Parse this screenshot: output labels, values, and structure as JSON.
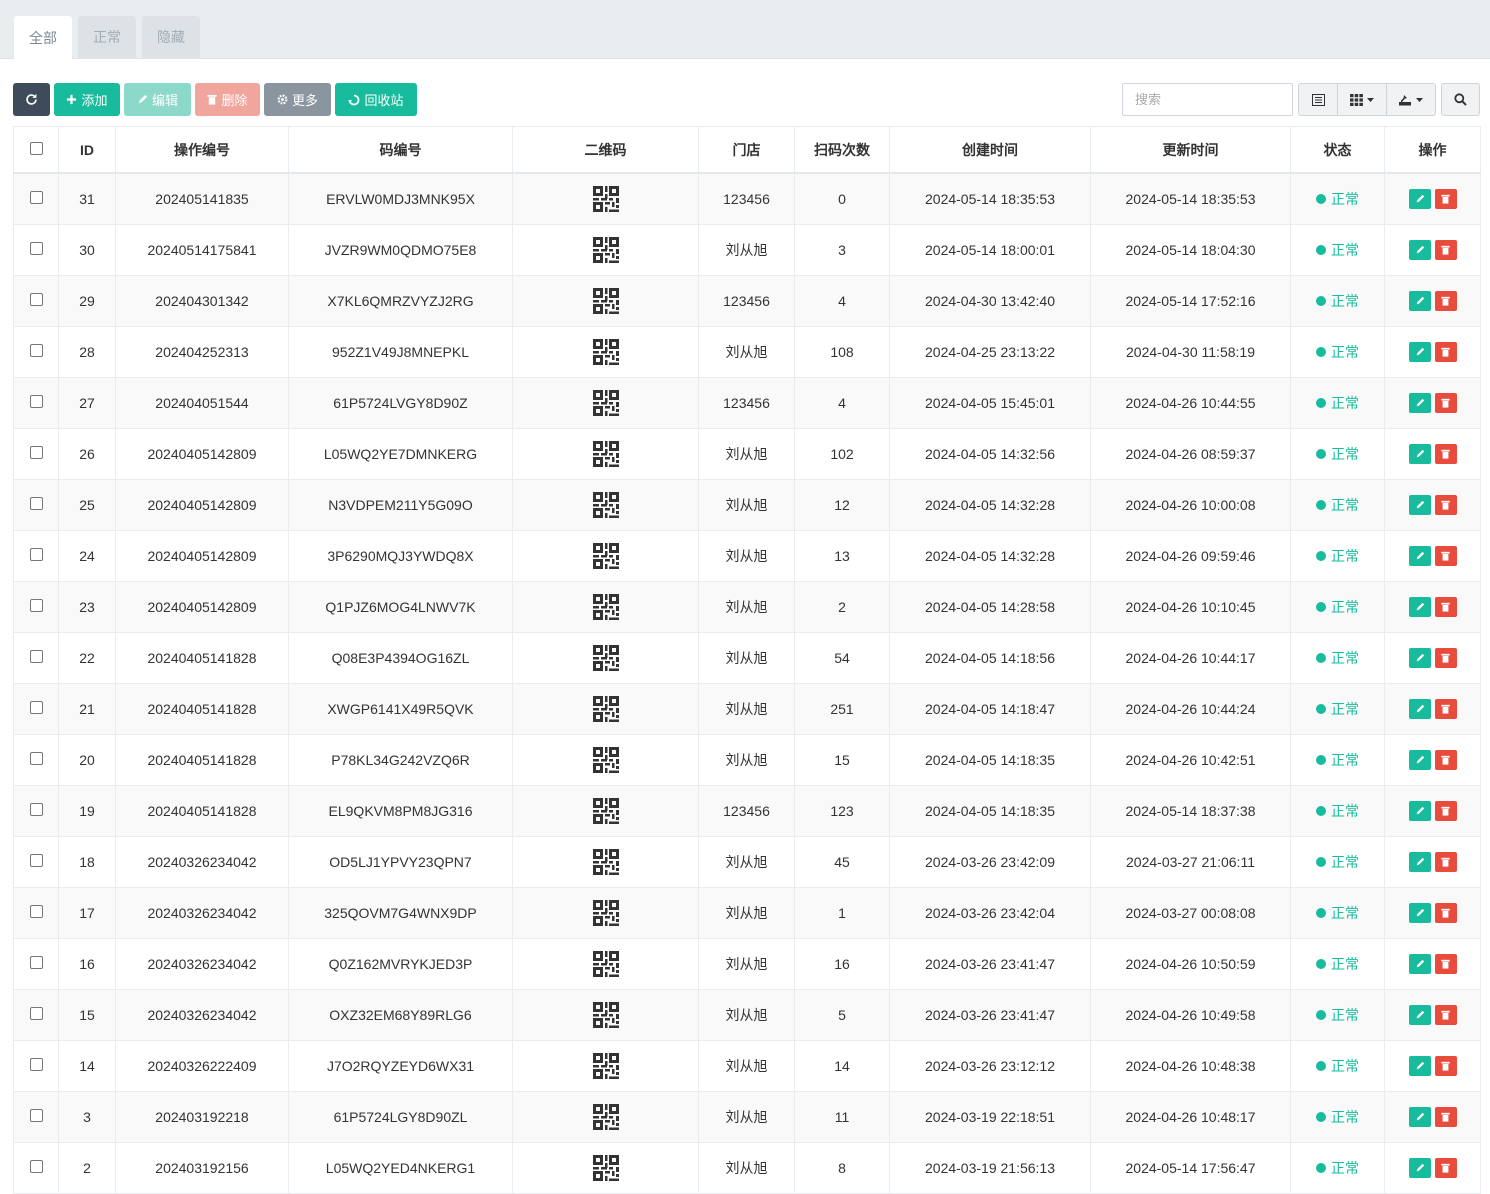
{
  "tabs": [
    {
      "label": "全部",
      "active": true
    },
    {
      "label": "正常",
      "active": false
    },
    {
      "label": "隐藏",
      "active": false
    }
  ],
  "toolbar": {
    "add_label": "添加",
    "edit_label": "编辑",
    "delete_label": "删除",
    "more_label": "更多",
    "recycle_label": "回收站"
  },
  "search": {
    "placeholder": "搜索",
    "value": ""
  },
  "table": {
    "headers": [
      "ID",
      "操作编号",
      "码编号",
      "二维码",
      "门店",
      "扫码次数",
      "创建时间",
      "更新时间",
      "状态",
      "操作"
    ],
    "rows": [
      {
        "id": "31",
        "op_no": "202405141835",
        "code": "ERVLW0MDJ3MNK95X",
        "store": "123456",
        "scans": "0",
        "created": "2024-05-14 18:35:53",
        "updated": "2024-05-14 18:35:53",
        "status": "正常"
      },
      {
        "id": "30",
        "op_no": "20240514175841",
        "code": "JVZR9WM0QDMO75E8",
        "store": "刘从旭",
        "scans": "3",
        "created": "2024-05-14 18:00:01",
        "updated": "2024-05-14 18:04:30",
        "status": "正常"
      },
      {
        "id": "29",
        "op_no": "202404301342",
        "code": "X7KL6QMRZVYZJ2RG",
        "store": "123456",
        "scans": "4",
        "created": "2024-04-30 13:42:40",
        "updated": "2024-05-14 17:52:16",
        "status": "正常"
      },
      {
        "id": "28",
        "op_no": "202404252313",
        "code": "952Z1V49J8MNEPKL",
        "store": "刘从旭",
        "scans": "108",
        "created": "2024-04-25 23:13:22",
        "updated": "2024-04-30 11:58:19",
        "status": "正常"
      },
      {
        "id": "27",
        "op_no": "202404051544",
        "code": "61P5724LVGY8D90Z",
        "store": "123456",
        "scans": "4",
        "created": "2024-04-05 15:45:01",
        "updated": "2024-04-26 10:44:55",
        "status": "正常"
      },
      {
        "id": "26",
        "op_no": "20240405142809",
        "code": "L05WQ2YE7DMNKERG",
        "store": "刘从旭",
        "scans": "102",
        "created": "2024-04-05 14:32:56",
        "updated": "2024-04-26 08:59:37",
        "status": "正常"
      },
      {
        "id": "25",
        "op_no": "20240405142809",
        "code": "N3VDPEM211Y5G09O",
        "store": "刘从旭",
        "scans": "12",
        "created": "2024-04-05 14:32:28",
        "updated": "2024-04-26 10:00:08",
        "status": "正常"
      },
      {
        "id": "24",
        "op_no": "20240405142809",
        "code": "3P6290MQJ3YWDQ8X",
        "store": "刘从旭",
        "scans": "13",
        "created": "2024-04-05 14:32:28",
        "updated": "2024-04-26 09:59:46",
        "status": "正常"
      },
      {
        "id": "23",
        "op_no": "20240405142809",
        "code": "Q1PJZ6MOG4LNWV7K",
        "store": "刘从旭",
        "scans": "2",
        "created": "2024-04-05 14:28:58",
        "updated": "2024-04-26 10:10:45",
        "status": "正常"
      },
      {
        "id": "22",
        "op_no": "20240405141828",
        "code": "Q08E3P4394OG16ZL",
        "store": "刘从旭",
        "scans": "54",
        "created": "2024-04-05 14:18:56",
        "updated": "2024-04-26 10:44:17",
        "status": "正常"
      },
      {
        "id": "21",
        "op_no": "20240405141828",
        "code": "XWGP6141X49R5QVK",
        "store": "刘从旭",
        "scans": "251",
        "created": "2024-04-05 14:18:47",
        "updated": "2024-04-26 10:44:24",
        "status": "正常"
      },
      {
        "id": "20",
        "op_no": "20240405141828",
        "code": "P78KL34G242VZQ6R",
        "store": "刘从旭",
        "scans": "15",
        "created": "2024-04-05 14:18:35",
        "updated": "2024-04-26 10:42:51",
        "status": "正常"
      },
      {
        "id": "19",
        "op_no": "20240405141828",
        "code": "EL9QKVM8PM8JG316",
        "store": "123456",
        "scans": "123",
        "created": "2024-04-05 14:18:35",
        "updated": "2024-05-14 18:37:38",
        "status": "正常"
      },
      {
        "id": "18",
        "op_no": "20240326234042",
        "code": "OD5LJ1YPVY23QPN7",
        "store": "刘从旭",
        "scans": "45",
        "created": "2024-03-26 23:42:09",
        "updated": "2024-03-27 21:06:11",
        "status": "正常"
      },
      {
        "id": "17",
        "op_no": "20240326234042",
        "code": "325QOVM7G4WNX9DP",
        "store": "刘从旭",
        "scans": "1",
        "created": "2024-03-26 23:42:04",
        "updated": "2024-03-27 00:08:08",
        "status": "正常"
      },
      {
        "id": "16",
        "op_no": "20240326234042",
        "code": "Q0Z162MVRYKJED3P",
        "store": "刘从旭",
        "scans": "16",
        "created": "2024-03-26 23:41:47",
        "updated": "2024-04-26 10:50:59",
        "status": "正常"
      },
      {
        "id": "15",
        "op_no": "20240326234042",
        "code": "OXZ32EM68Y89RLG6",
        "store": "刘从旭",
        "scans": "5",
        "created": "2024-03-26 23:41:47",
        "updated": "2024-04-26 10:49:58",
        "status": "正常"
      },
      {
        "id": "14",
        "op_no": "20240326222409",
        "code": "J7O2RQYZEYD6WX31",
        "store": "刘从旭",
        "scans": "14",
        "created": "2024-03-26 23:12:12",
        "updated": "2024-04-26 10:48:38",
        "status": "正常"
      },
      {
        "id": "3",
        "op_no": "202403192218",
        "code": "61P5724LGY8D90ZL",
        "store": "刘从旭",
        "scans": "11",
        "created": "2024-03-19 22:18:51",
        "updated": "2024-04-26 10:48:17",
        "status": "正常"
      },
      {
        "id": "2",
        "op_no": "202403192156",
        "code": "L05WQ2YED4NKERG1",
        "store": "刘从旭",
        "scans": "8",
        "created": "2024-03-19 21:56:13",
        "updated": "2024-05-14 17:56:47",
        "status": "正常"
      }
    ]
  },
  "colors": {
    "primary": "#18bc9c",
    "danger": "#e74c3c",
    "dark": "#3d4b5a"
  },
  "icons": {
    "refresh": "refresh-icon",
    "add": "plus-icon",
    "edit": "pencil-icon",
    "delete": "trash-icon",
    "more": "gear-icon",
    "recycle": "recycle-icon",
    "list": "list-icon",
    "columns": "grid-icon",
    "export": "export-icon",
    "search": "search-icon",
    "qrcode": "qrcode-icon"
  }
}
